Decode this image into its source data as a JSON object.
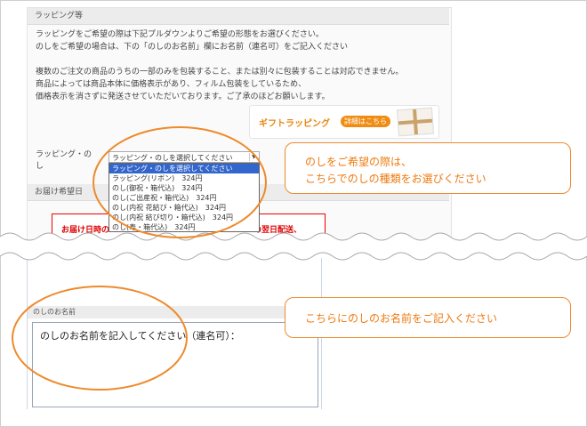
{
  "wrapping": {
    "section_title": "ラッピング等",
    "intro_lines": [
      "ラッピングをご希望の際は下記プルダウンよりご希望の形態をお選びください。",
      "のしをご希望の場合は、下の「のしのお名前」欄にお名前（連名可）をご記入ください",
      "",
      "複数のご注文の商品のうちの一部のみを包装すること、または別々に包装することは対応できません。",
      "商品によっては商品本体に価格表示があり、フィルム包装をしているため、",
      "価格表示を消さずに発送させていただいております。ご了承のほどお願いします。"
    ],
    "gift_button": {
      "label": "ギフトラッピング",
      "detail": "詳細はこちら"
    },
    "select_label": "ラッピング・のし",
    "select_value": "ラッピング・のしを選択してください",
    "options": [
      "ラッピング・のしを選択してください",
      "ラッピング(リボン)　324円",
      "のし(御祝・箱代込)　324円",
      "のし(ご出産祝・箱代込)　324円",
      "のし(内祝 花結び・箱代込)　324円",
      "のし(内祝 結び切り・箱代込)　324円",
      "のし(寿・箱代込)　324円"
    ]
  },
  "delivery": {
    "section_title": "お届け希望日",
    "notice_left": "お届け日時の",
    "notice_right": "の翌日配送、"
  },
  "noshi_name": {
    "section_title": "のしのお名前",
    "text": "のしのお名前を記入してください（連名可）："
  },
  "callouts": {
    "select_hint_line1": "のしをご希望の際は、",
    "select_hint_line2": "こちらでのしの種類をお選びください",
    "name_hint": "こちらにのしのお名前をご記入ください"
  },
  "colors": {
    "accent": "#ee8a2c",
    "selected": "#3366cc",
    "notice": "#dd0000"
  }
}
